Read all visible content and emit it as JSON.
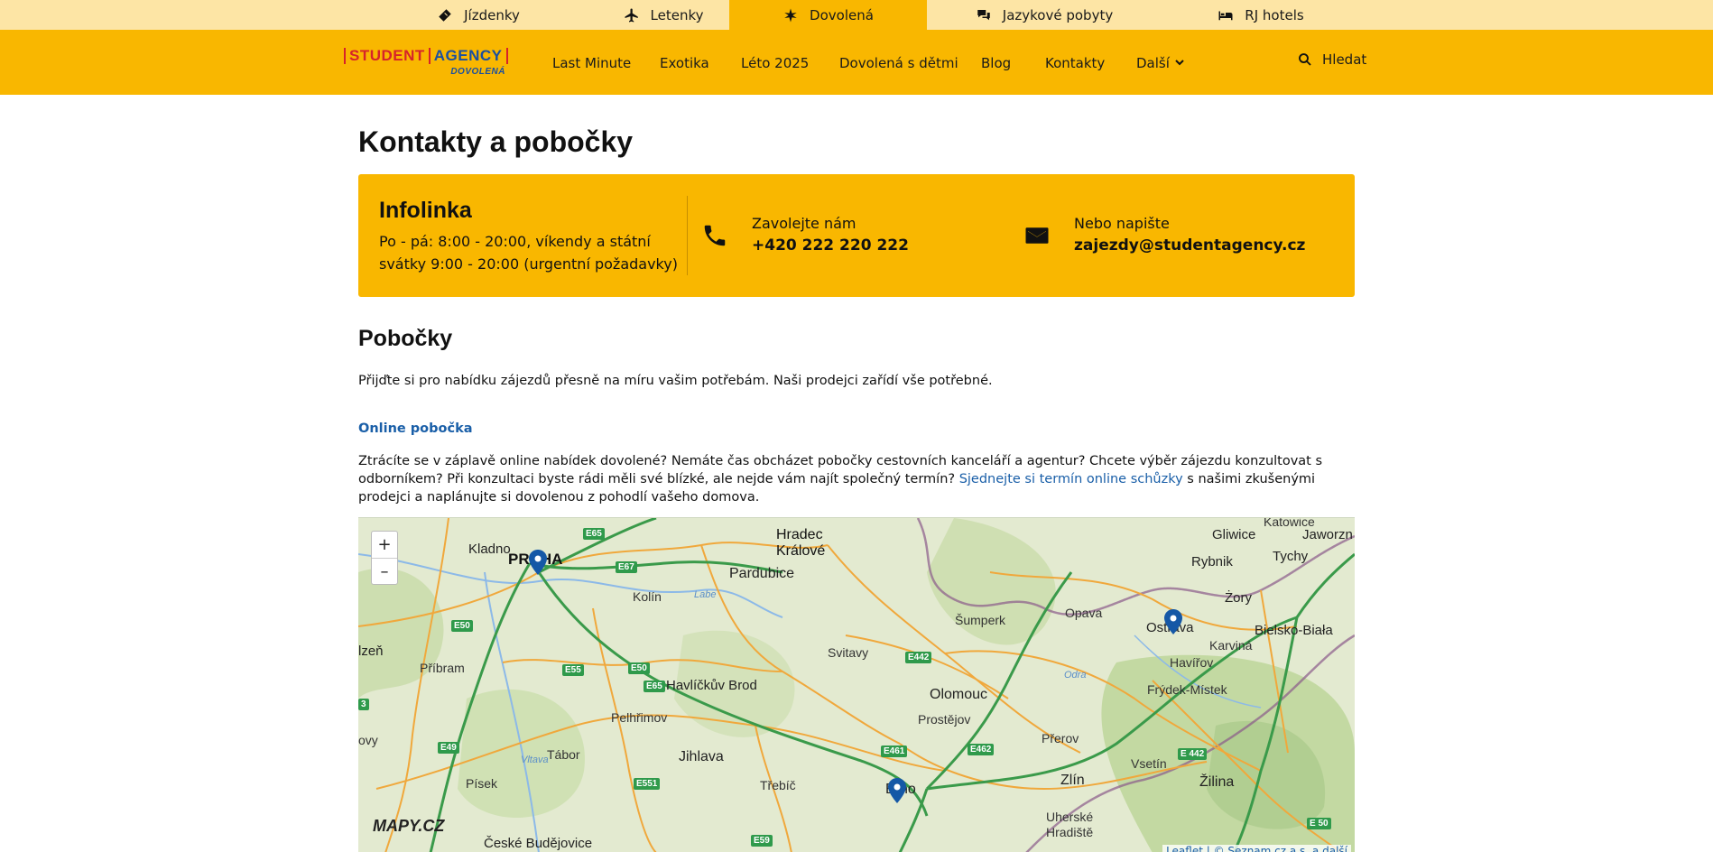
{
  "topbar": {
    "tabs": [
      {
        "label": "Jízdenky",
        "icon": "ticket-icon"
      },
      {
        "label": "Letenky",
        "icon": "plane-icon"
      },
      {
        "label": "Dovolená",
        "icon": "palm-icon",
        "active": true
      },
      {
        "label": "Jazykové pobyty",
        "icon": "chat-icon"
      },
      {
        "label": "RJ hotels",
        "icon": "bed-icon"
      }
    ]
  },
  "header": {
    "logo": {
      "student": "STUDENT",
      "agency": "AGENCY",
      "sub": "DOVOLENÁ"
    },
    "nav": [
      "Last Minute",
      "Exotika",
      "Léto 2025",
      "Dovolená s dětmi",
      "Blog",
      "Kontakty",
      "Další"
    ],
    "search_label": "Hledat"
  },
  "page": {
    "title": "Kontakty a pobočky",
    "infolinka": {
      "title": "Infolinka",
      "hours": "Po - pá: 8:00 - 20:00, víkendy a státní svátky 9:00 - 20:00 (urgentní požadavky)"
    },
    "call": {
      "label": "Zavolejte nám",
      "value": "+420 222 220 222"
    },
    "write": {
      "label": "Nebo napište",
      "value": "zajezdy@studentagency.cz"
    },
    "branches_title": "Pobočky",
    "branches_intro": "Přijďte si pro nabídku zájezdů přesně na míru vašim potřebám. Naši prodejci zařídí vše potřebné.",
    "online_branch": "Online pobočka",
    "para_before": "Ztrácíte se v záplavě online nabídek dovolené? Nemáte čas obcházet pobočky cestovních kanceláří a agentur? Chcete výběr zájezdu konzultovat s odborníkem? Při konzultaci byste rádi měli své blízké, ale nejde vám najít společný termín? ",
    "para_link": "Sjednejte si termín online schůzky",
    "para_after": " s našimi zkušenými prodejci a naplánujte si dovolenou z pohodlí vašeho domova."
  },
  "map": {
    "zoom_in": "+",
    "zoom_out": "–",
    "logo": "MAPY.CZ",
    "attribution": "Leaflet | © Seznam.cz a.s. a další",
    "labels": {
      "praha": "PRAHA",
      "kladno": "Kladno",
      "hradec": "Hradec",
      "kralove": "Králové",
      "pardubice": "Pardubice",
      "kolin": "Kolín",
      "labe": "Labe",
      "plzen": "lzeň",
      "pribram": "Příbram",
      "havlickuv": "Havlíčkův Brod",
      "svitavy": "Svitavy",
      "sumperk": "Šumperk",
      "opava": "Opava",
      "ostrava": "Ostrava",
      "olomouc": "Olomouc",
      "prostejov": "Prostějov",
      "prerov": "Přerov",
      "pelhrimov": "Pelhřimov",
      "tabor": "Tábor",
      "jihlava": "Jihlava",
      "trebic": "Třebíč",
      "brno": "Brno",
      "pisek": "Písek",
      "cb": "České Budějovice",
      "zlin": "Zlín",
      "vsetin": "Vsetín",
      "zilina": "Žilina",
      "uh": "Uherské",
      "uh2": "Hradiště",
      "frydek": "Frýdek-Místek",
      "havirov": "Havířov",
      "karvina": "Karviná",
      "bielsko": "Bielsko-Biała",
      "zory": "Żory",
      "rybnik": "Rybnik",
      "tychy": "Tychy",
      "gliwice": "Gliwice",
      "katowice": "Katowice",
      "jaworzno": "Jaworzn",
      "odra": "Odra",
      "vltava": "Vltava",
      "ovy": "ovy"
    },
    "roads": {
      "e65a": "E65",
      "e67": "E67",
      "e50a": "E50",
      "e55": "E55",
      "e50b": "E50",
      "e65b": "E65",
      "e442a": "E442",
      "e461": "E461",
      "e462": "E462",
      "e442b": "E 442",
      "e49": "E49",
      "e551": "E551",
      "e59": "E59",
      "e50c": "E 50",
      "e3": "3"
    }
  }
}
